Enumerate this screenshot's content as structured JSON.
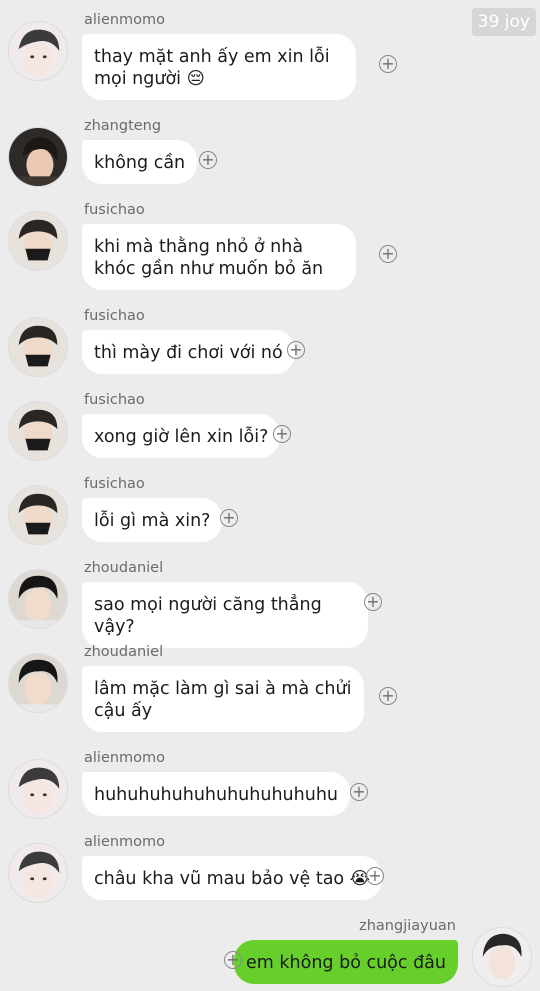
{
  "watermark": "39 joy",
  "messages": [
    {
      "user": "alienmomo",
      "text": "thay mặt anh ấy em xin lỗi mọi người 😔",
      "avatar": "alienmomo-avatar"
    },
    {
      "user": "zhangteng",
      "text": "không cần",
      "avatar": "zhangteng-avatar"
    },
    {
      "user": "fusichao",
      "text": "khi mà thằng nhỏ ở nhà khóc gần như muốn bỏ ăn",
      "avatar": "fusichao-avatar"
    },
    {
      "user": "fusichao",
      "text": "thì mày đi chơi với nó",
      "avatar": "fusichao-avatar"
    },
    {
      "user": "fusichao",
      "text": "xong giờ lên xin lỗi?",
      "avatar": "fusichao-avatar"
    },
    {
      "user": "fusichao",
      "text": "lỗi gì mà xin?",
      "avatar": "fusichao-avatar"
    },
    {
      "user": "zhoudaniel",
      "text": "sao mọi người căng thẳng vậy?",
      "avatar": "zhoudaniel-avatar"
    },
    {
      "user": "zhoudaniel",
      "text": "lâm mặc làm gì sai à mà chửi cậu ấy",
      "avatar": "zhoudaniel-avatar"
    },
    {
      "user": "alienmomo",
      "text": "huhuhuhuhuhuhuhuhuhuhu",
      "avatar": "alienmomo-avatar"
    },
    {
      "user": "alienmomo",
      "text": "châu kha vũ mau bảo vệ tao 😭",
      "avatar": "alienmomo-avatar"
    },
    {
      "user": "zhangjiayuan",
      "text": "em không bỏ cuộc đâu",
      "avatar": "zhangjiayuan-avatar",
      "self": true
    }
  ],
  "plus_symbol": "+",
  "colors": {
    "background": "#ececec",
    "incoming_bubble": "#ffffff",
    "outgoing_bubble": "#66cf2b"
  }
}
